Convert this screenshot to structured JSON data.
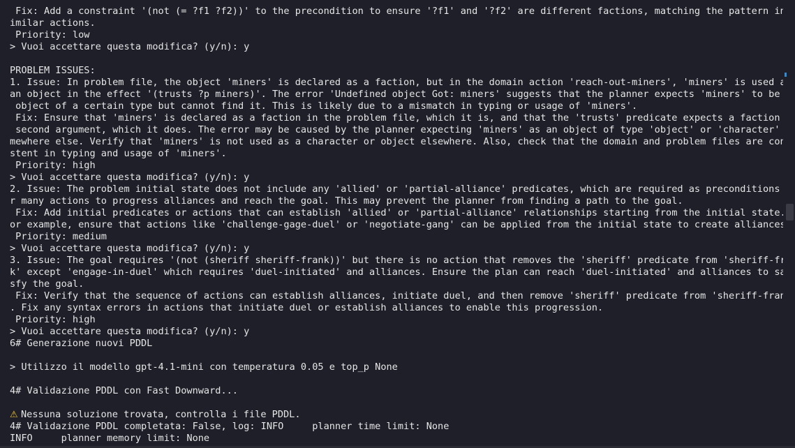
{
  "terminal": {
    "lines": [
      " Fix: Add a constraint '(not (= ?f1 ?f2))' to the precondition to ensure '?f1' and '?f2' are different factions, matching the pattern in s",
      "imilar actions.",
      " Priority: low",
      "> Vuoi accettare questa modifica? (y/n): y",
      "",
      "PROBLEM ISSUES:",
      "1. Issue: In problem file, the object 'miners' is declared as a faction, but in the domain action 'reach-out-miners', 'miners' is used as",
      "an object in the effect '(trusts ?p miners)'. The error 'Undefined object Got: miners' suggests that the planner expects 'miners' to be an",
      " object of a certain type but cannot find it. This is likely due to a mismatch in typing or usage of 'miners'.",
      " Fix: Ensure that 'miners' is declared as a faction in the problem file, which it is, and that the 'trusts' predicate expects a faction as",
      " second argument, which it does. The error may be caused by the planner expecting 'miners' as an object of type 'object' or 'character' so",
      "mewhere else. Verify that 'miners' is not used as a character or object elsewhere. Also, check that the domain and problem files are consi",
      "stent in typing and usage of 'miners'.",
      " Priority: high",
      "> Vuoi accettare questa modifica? (y/n): y",
      "2. Issue: The problem initial state does not include any 'allied' or 'partial-alliance' predicates, which are required as preconditions fo",
      "r many actions to progress alliances and reach the goal. This may prevent the planner from finding a path to the goal.",
      " Fix: Add initial predicates or actions that can establish 'allied' or 'partial-alliance' relationships starting from the initial state. F",
      "or example, ensure that actions like 'challenge-gage-duel' or 'negotiate-gang' can be applied from the initial state to create alliances.",
      " Priority: medium",
      "> Vuoi accettare questa modifica? (y/n): y",
      "3. Issue: The goal requires '(not (sheriff sheriff-frank))' but there is no action that removes the 'sheriff' predicate from 'sheriff-fran",
      "k' except 'engage-in-duel' which requires 'duel-initiated' and alliances. Ensure the plan can reach 'duel-initiated' and alliances to sati",
      "sfy the goal.",
      " Fix: Verify that the sequence of actions can establish alliances, initiate duel, and then remove 'sheriff' predicate from 'sheriff-frank'",
      ". Fix any syntax errors in actions that initiate duel or establish alliances to enable this progression.",
      " Priority: high",
      "> Vuoi accettare questa modifica? (y/n): y",
      "6# Generazione nuovi PDDL",
      "",
      "> Utilizzo il modello gpt-4.1-mini con temperatura 0.05 e top_p None",
      "",
      "4# Validazione PDDL con Fast Downward...",
      "",
      "Nessuna soluzione trovata, controlla i file PDDL.",
      "4# Validazione PDDL completata: False, log: INFO     planner time limit: None",
      "INFO     planner memory limit: None"
    ],
    "warning_icon": "warning-icon",
    "warning_glyph": "⚠",
    "colors": {
      "background": "#1e1f29",
      "text": "#e6e6e6",
      "warning": "#f2c230",
      "scroll_marker": "#2f8fd6"
    }
  }
}
